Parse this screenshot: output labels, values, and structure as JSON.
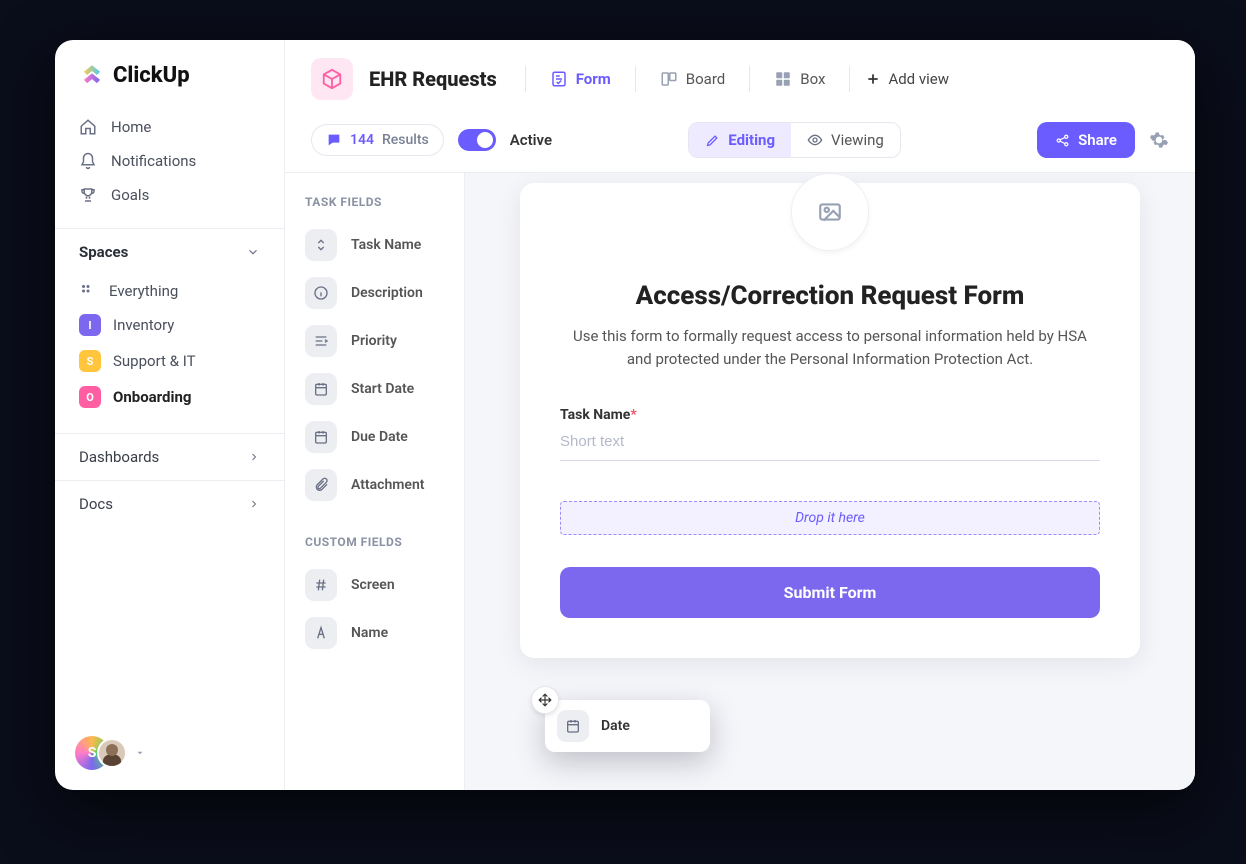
{
  "brand": {
    "name": "ClickUp"
  },
  "sidebar": {
    "nav": [
      {
        "label": "Home",
        "icon": "home"
      },
      {
        "label": "Notifications",
        "icon": "bell"
      },
      {
        "label": "Goals",
        "icon": "trophy"
      }
    ],
    "spaces_header": "Spaces",
    "everything_label": "Everything",
    "spaces": [
      {
        "letter": "I",
        "label": "Inventory",
        "color": "#7b68ee"
      },
      {
        "letter": "S",
        "label": "Support & IT",
        "color": "#ffc53d"
      },
      {
        "letter": "O",
        "label": "Onboarding",
        "color": "#ff5fa2",
        "active": true
      }
    ],
    "dashboards_label": "Dashboards",
    "docs_label": "Docs",
    "footer": {
      "avatar_letter": "S"
    }
  },
  "header": {
    "list_title": "EHR Requests",
    "views": [
      {
        "label": "Form",
        "active": true
      },
      {
        "label": "Board"
      },
      {
        "label": "Box"
      }
    ],
    "add_view_label": "Add view"
  },
  "toolbar": {
    "results_count": "144",
    "results_label": "Results",
    "active_label": "Active",
    "editing_label": "Editing",
    "viewing_label": "Viewing",
    "share_label": "Share"
  },
  "fields": {
    "task_heading": "TASK FIELDS",
    "task": [
      {
        "label": "Task Name",
        "icon": "updown"
      },
      {
        "label": "Description",
        "icon": "info"
      },
      {
        "label": "Priority",
        "icon": "priority"
      },
      {
        "label": "Start Date",
        "icon": "calendar"
      },
      {
        "label": "Due Date",
        "icon": "calendar"
      },
      {
        "label": "Attachment",
        "icon": "clip"
      }
    ],
    "custom_heading": "CUSTOM FIELDS",
    "custom": [
      {
        "label": "Screen",
        "icon": "hash"
      },
      {
        "label": "Name",
        "icon": "atype"
      }
    ]
  },
  "drag": {
    "label": "Date"
  },
  "form": {
    "title": "Access/Correction Request Form",
    "desc": "Use this form to formally request access to personal information held by HSA and protected under the Personal Information Protection Act.",
    "field1_label": "Task Name",
    "field1_placeholder": "Short text",
    "drop_hint": "Drop it here",
    "submit_label": "Submit Form"
  }
}
